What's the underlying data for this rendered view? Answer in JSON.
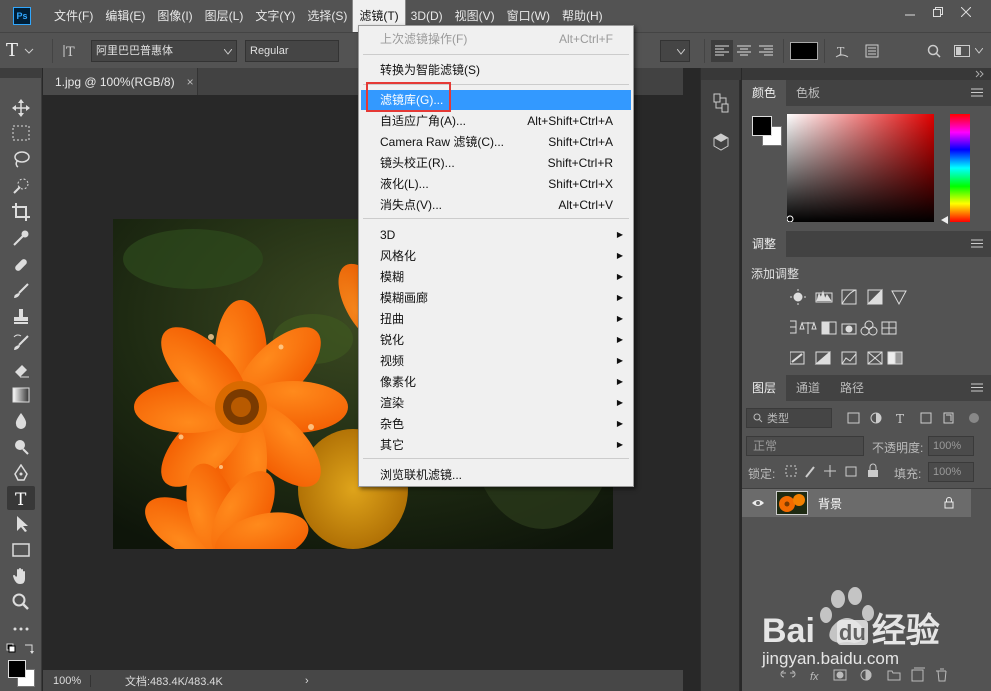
{
  "menubar": {
    "items": [
      "文件(F)",
      "编辑(E)",
      "图像(I)",
      "图层(L)",
      "文字(Y)",
      "选择(S)",
      "滤镜(T)",
      "3D(D)",
      "视图(V)",
      "窗口(W)",
      "帮助(H)"
    ],
    "logo": "Ps"
  },
  "options": {
    "font_family": "阿里巴巴普惠体",
    "font_style": "Regular"
  },
  "document": {
    "tab_title": "1.jpg @ 100%(RGB/8)",
    "close_glyph": "×",
    "zoom": "100%",
    "doc_info": "文档:483.4K/483.4K",
    "status_arrow": "›"
  },
  "filter_menu": {
    "items": [
      {
        "label": "上次滤镜操作(F)",
        "shortcut": "Alt+Ctrl+F",
        "state": "disabled"
      },
      {
        "label": "转换为智能滤镜(S)",
        "shortcut": "",
        "state": "normal"
      },
      {
        "label": "滤镜库(G)...",
        "shortcut": "",
        "state": "highlight"
      },
      {
        "label": "自适应广角(A)...",
        "shortcut": "Alt+Shift+Ctrl+A",
        "state": "normal"
      },
      {
        "label": "Camera Raw 滤镜(C)...",
        "shortcut": "Shift+Ctrl+A",
        "state": "normal"
      },
      {
        "label": "镜头校正(R)...",
        "shortcut": "Shift+Ctrl+R",
        "state": "normal"
      },
      {
        "label": "液化(L)...",
        "shortcut": "Shift+Ctrl+X",
        "state": "normal"
      },
      {
        "label": "消失点(V)...",
        "shortcut": "Alt+Ctrl+V",
        "state": "normal"
      },
      {
        "label": "3D",
        "submenu": true
      },
      {
        "label": "风格化",
        "submenu": true
      },
      {
        "label": "模糊",
        "submenu": true
      },
      {
        "label": "模糊画廊",
        "submenu": true
      },
      {
        "label": "扭曲",
        "submenu": true
      },
      {
        "label": "锐化",
        "submenu": true
      },
      {
        "label": "视频",
        "submenu": true
      },
      {
        "label": "像素化",
        "submenu": true
      },
      {
        "label": "渲染",
        "submenu": true
      },
      {
        "label": "杂色",
        "submenu": true
      },
      {
        "label": "其它",
        "submenu": true
      },
      {
        "label": "浏览联机滤镜...",
        "shortcut": "",
        "state": "normal"
      }
    ]
  },
  "color_panel": {
    "tabs": [
      "颜色",
      "色板"
    ],
    "foreground": "#000000",
    "background": "#ffffff",
    "hue_color": "#e00000"
  },
  "adjust_panel": {
    "tab": "调整",
    "title": "添加调整"
  },
  "layers_panel": {
    "tabs": [
      "图层",
      "通道",
      "路径"
    ],
    "filter_label": "类型",
    "blend_mode": "正常",
    "opacity_label": "不透明度:",
    "opacity_value": "100%",
    "lock_label": "锁定:",
    "fill_label": "填充:",
    "fill_value": "100%",
    "layer_name": "背景"
  },
  "watermark": {
    "brand": "Bai",
    "brand2": "du",
    "brand3": "经验",
    "url": "jingyan.baidu.com"
  },
  "colors": {
    "ui_dark": "#282828",
    "ui_panel": "#535353",
    "menu_highlight": "#3399ff",
    "annotation_red": "#e53935"
  }
}
